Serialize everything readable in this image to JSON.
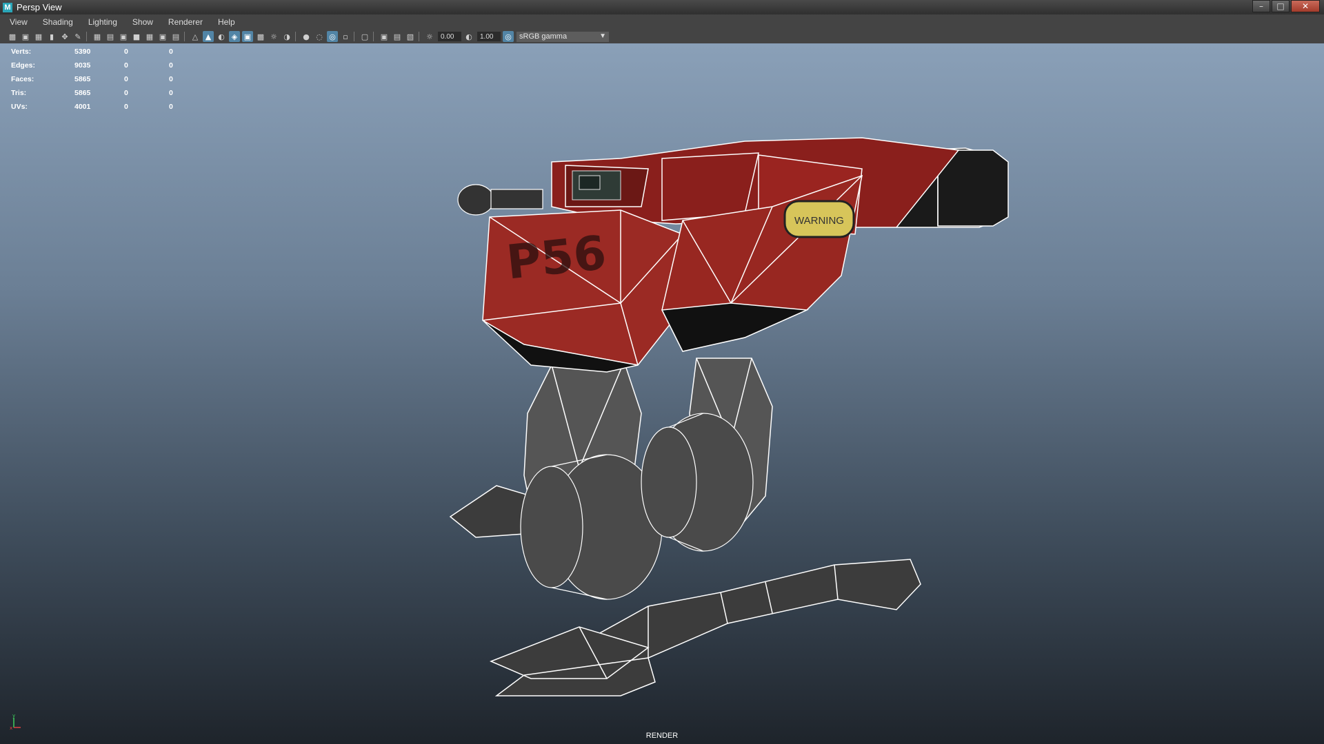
{
  "window": {
    "title": "Persp View",
    "app_icon_letter": "M"
  },
  "menu": [
    "View",
    "Shading",
    "Lighting",
    "Show",
    "Renderer",
    "Help"
  ],
  "toolbar": {
    "exposure": "0.00",
    "gamma": "1.00",
    "color_space": "sRGB gamma",
    "icons": [
      "camera-icon",
      "camera-attr-icon",
      "bookmark-icon",
      "image-plane-icon",
      "2d-pan-icon",
      "grease-pencil-icon",
      "grid-icon",
      "film-gate-icon",
      "resolution-gate-icon",
      "gate-mask-icon",
      "field-chart-icon",
      "safe-action-icon",
      "safe-title-icon",
      "wireframe-icon",
      "smooth-shade-icon",
      "default-lighting-icon",
      "wireframe-on-shaded-icon",
      "xray-icon",
      "textured-icon",
      "lights-icon",
      "shadows-icon",
      "ambient-occlusion-icon",
      "motion-blur-icon",
      "anti-aliasing-icon",
      "depth-of-field-icon",
      "isolate-select-icon",
      "xray-joints-icon",
      "hud-icon",
      "exposure-icon",
      "gamma-icon",
      "color-management-icon"
    ]
  },
  "hud": {
    "rows": [
      {
        "label": "Verts:",
        "value": "5390",
        "sel": "0",
        "other": "0"
      },
      {
        "label": "Edges:",
        "value": "9035",
        "sel": "0",
        "other": "0"
      },
      {
        "label": "Faces:",
        "value": "5865",
        "sel": "0",
        "other": "0"
      },
      {
        "label": "Tris:",
        "value": "5865",
        "sel": "0",
        "other": "0"
      },
      {
        "label": "UVs:",
        "value": "4001",
        "sel": "0",
        "other": "0"
      }
    ]
  },
  "model": {
    "decal_text": "P56",
    "warning_text": "WARNING"
  },
  "axis": {
    "y": "y",
    "x": "x"
  },
  "footer": {
    "label": "RENDER"
  }
}
